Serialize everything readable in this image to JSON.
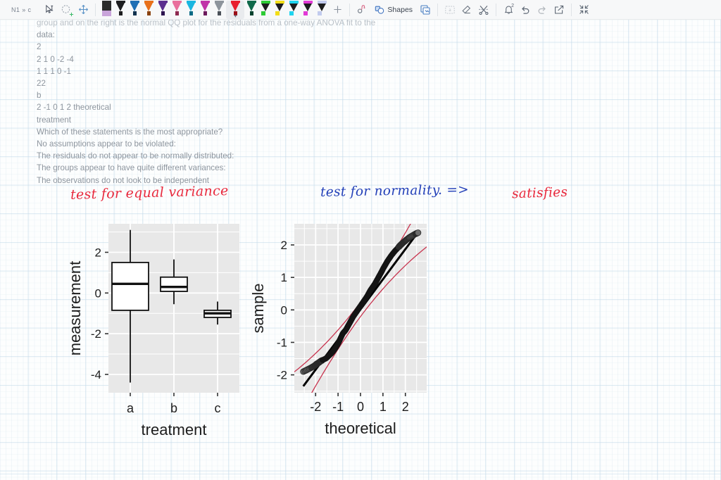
{
  "toolbar": {
    "doc_label": "N1 » c",
    "tools": [
      {
        "name": "select-text-tool",
        "icon": "cursor-text-icon",
        "label": "Select"
      },
      {
        "name": "lasso-tool",
        "icon": "lasso-icon",
        "label": "Lasso"
      },
      {
        "name": "move-tool",
        "icon": "move-arrows-icon",
        "label": "Move"
      }
    ],
    "pens": [
      {
        "name": "pen-lavender",
        "color": "#c9a4da",
        "cap": "#2b2b2b",
        "selected": false,
        "upright": true
      },
      {
        "name": "pen-black",
        "color": "#1d1d1f",
        "cap": "#1d1d1f",
        "selected": false,
        "upright": false
      },
      {
        "name": "pen-blue",
        "color": "#1f6fb5",
        "cap": "#12334f",
        "selected": false,
        "upright": false
      },
      {
        "name": "pen-orange",
        "color": "#e8701a",
        "cap": "#8a4210",
        "selected": false,
        "upright": false
      },
      {
        "name": "pen-deep-purple",
        "color": "#5c2f8f",
        "cap": "#2e1550",
        "selected": false,
        "upright": false
      },
      {
        "name": "pen-pink",
        "color": "#e9709c",
        "cap": "#8e2a50",
        "selected": false,
        "upright": false
      },
      {
        "name": "pen-cyan",
        "color": "#1ab6e0",
        "cap": "#0d6a85",
        "selected": false,
        "upright": false
      },
      {
        "name": "pen-magenta",
        "color": "#c033a8",
        "cap": "#6c1a5c",
        "selected": false,
        "upright": false
      },
      {
        "name": "pen-gray",
        "color": "#8d949c",
        "cap": "#4b5159",
        "selected": false,
        "upright": false
      },
      {
        "name": "pen-red",
        "color": "#e81f2e",
        "cap": "#9b0e18",
        "selected": true,
        "upright": false
      },
      {
        "name": "pen-dark-green",
        "color": "#10694a",
        "cap": "#07422e",
        "selected": false,
        "upright": false
      }
    ],
    "highlighters": [
      {
        "name": "highlighter-green",
        "color": "#2ecb36"
      },
      {
        "name": "highlighter-yellow",
        "color": "#f2dd17"
      },
      {
        "name": "highlighter-cyan",
        "color": "#20d4ef"
      },
      {
        "name": "highlighter-magenta",
        "color": "#e23ad6"
      },
      {
        "name": "highlighter-lavender",
        "color": "#c2cbee"
      }
    ],
    "add_pen_label": "+",
    "shapes_label": "Shapes",
    "right_tools": [
      {
        "name": "sticker-tool",
        "icon": "sticker-icon"
      },
      {
        "name": "image-tool",
        "icon": "image-frame-icon"
      },
      {
        "name": "text-box-tool",
        "icon": "text-box-icon"
      },
      {
        "name": "eraser-tool",
        "icon": "eraser-icon"
      },
      {
        "name": "scissors-tool",
        "icon": "scissors-icon"
      },
      {
        "name": "notifications",
        "icon": "bell-icon",
        "badge": "2"
      },
      {
        "name": "undo",
        "icon": "undo-arrow-icon"
      },
      {
        "name": "redo",
        "icon": "redo-arrow-icon"
      },
      {
        "name": "share",
        "icon": "share-export-icon"
      },
      {
        "name": "collapse",
        "icon": "collapse-arrows-icon"
      }
    ]
  },
  "document": {
    "lines": [
      "group and on the right is the normal QQ plot for the residuals from a one-way ANOVA fit to the",
      "data:",
      "2",
      "2 1 0 -2 -4",
      "1 1 1 0 -1",
      "22",
      "b",
      "2 -1 0 1 2 theoretical",
      "treatment",
      "Which of these statements is the most appropriate?",
      "No assumptions appear to be violated:",
      "The residuals do not appear to be normally distributed:",
      "The groups appear to have quite different variances:",
      "The observations do not look to be independent"
    ]
  },
  "annotations": [
    {
      "name": "annotation-equal-variance",
      "text": "test for equal variance",
      "color": "#e8283c"
    },
    {
      "name": "annotation-normality",
      "text": "test for normality. =>",
      "color": "#2340b8"
    },
    {
      "name": "annotation-satisfies",
      "text": "satisfies",
      "color": "#e8283c"
    }
  ],
  "chart_data": [
    {
      "type": "boxplot",
      "name": "boxplot-measurement-by-treatment",
      "title": "",
      "xlabel": "treatment",
      "ylabel": "measurement",
      "categories": [
        "a",
        "b",
        "c"
      ],
      "ylim": [
        -4.9,
        3.4
      ],
      "yticks": [
        2,
        0,
        -2,
        -4
      ],
      "grid": true,
      "panel_bg": "#e8e8e8",
      "boxes": [
        {
          "category": "a",
          "lower_whisker": -4.4,
          "q1": -0.85,
          "median": 0.45,
          "q3": 1.5,
          "upper_whisker": 3.1
        },
        {
          "category": "b",
          "lower_whisker": -0.55,
          "q1": 0.08,
          "median": 0.3,
          "q3": 0.78,
          "upper_whisker": 1.65
        },
        {
          "category": "c",
          "lower_whisker": -1.55,
          "q1": -1.2,
          "median": -1.0,
          "q3": -0.85,
          "upper_whisker": -0.42
        }
      ]
    },
    {
      "type": "scatter",
      "name": "qq-plot-residuals",
      "title": "",
      "xlabel": "theoretical",
      "ylabel": "sample",
      "xlim": [
        -2.95,
        2.95
      ],
      "ylim": [
        -2.55,
        2.65
      ],
      "xticks": [
        -2,
        -1,
        0,
        1,
        2
      ],
      "yticks": [
        2,
        1,
        0,
        -1,
        -2
      ],
      "grid": true,
      "panel_bg": "#e8e8e8",
      "reference_line": {
        "color": "#000000",
        "x1": -2.55,
        "y1": -2.35,
        "x2": 2.55,
        "y2": 2.38
      },
      "confidence_band_color": "#c8344f",
      "point_color": "#151515",
      "points_x": [
        -2.55,
        -2.2,
        -2.05,
        -1.95,
        -1.85,
        -1.78,
        -1.7,
        -1.62,
        -1.55,
        -1.48,
        -1.42,
        -1.36,
        -1.3,
        -1.25,
        -1.2,
        -1.15,
        -1.1,
        -1.05,
        -1.0,
        -0.96,
        -0.92,
        -0.88,
        -0.84,
        -0.8,
        -0.76,
        -0.72,
        -0.68,
        -0.64,
        -0.6,
        -0.56,
        -0.52,
        -0.48,
        -0.44,
        -0.4,
        -0.36,
        -0.32,
        -0.28,
        -0.24,
        -0.2,
        -0.16,
        -0.12,
        -0.08,
        -0.04,
        0.0,
        0.04,
        0.08,
        0.12,
        0.16,
        0.2,
        0.24,
        0.28,
        0.32,
        0.36,
        0.4,
        0.44,
        0.48,
        0.52,
        0.56,
        0.6,
        0.64,
        0.68,
        0.72,
        0.76,
        0.8,
        0.84,
        0.88,
        0.92,
        0.96,
        1.0,
        1.05,
        1.1,
        1.15,
        1.2,
        1.26,
        1.32,
        1.38,
        1.45,
        1.52,
        1.6,
        1.68,
        1.76,
        1.85,
        1.95,
        2.05,
        2.2,
        2.45,
        2.58
      ],
      "points_y": [
        -1.9,
        -1.78,
        -1.72,
        -1.66,
        -1.62,
        -1.58,
        -1.55,
        -1.52,
        -1.5,
        -1.46,
        -1.42,
        -1.38,
        -1.34,
        -1.3,
        -1.26,
        -1.21,
        -1.16,
        -1.1,
        -1.04,
        -0.98,
        -0.92,
        -0.86,
        -0.8,
        -0.74,
        -0.7,
        -0.67,
        -0.64,
        -0.6,
        -0.55,
        -0.5,
        -0.45,
        -0.4,
        -0.35,
        -0.3,
        -0.25,
        -0.2,
        -0.16,
        -0.12,
        -0.08,
        -0.04,
        0.0,
        0.04,
        0.08,
        0.12,
        0.16,
        0.2,
        0.24,
        0.28,
        0.32,
        0.36,
        0.4,
        0.45,
        0.5,
        0.55,
        0.6,
        0.64,
        0.68,
        0.72,
        0.76,
        0.8,
        0.85,
        0.9,
        0.95,
        1.0,
        1.05,
        1.1,
        1.15,
        1.2,
        1.26,
        1.32,
        1.38,
        1.44,
        1.5,
        1.56,
        1.62,
        1.68,
        1.74,
        1.8,
        1.86,
        1.92,
        1.98,
        2.04,
        2.1,
        2.16,
        2.24,
        2.34,
        2.38
      ]
    }
  ]
}
